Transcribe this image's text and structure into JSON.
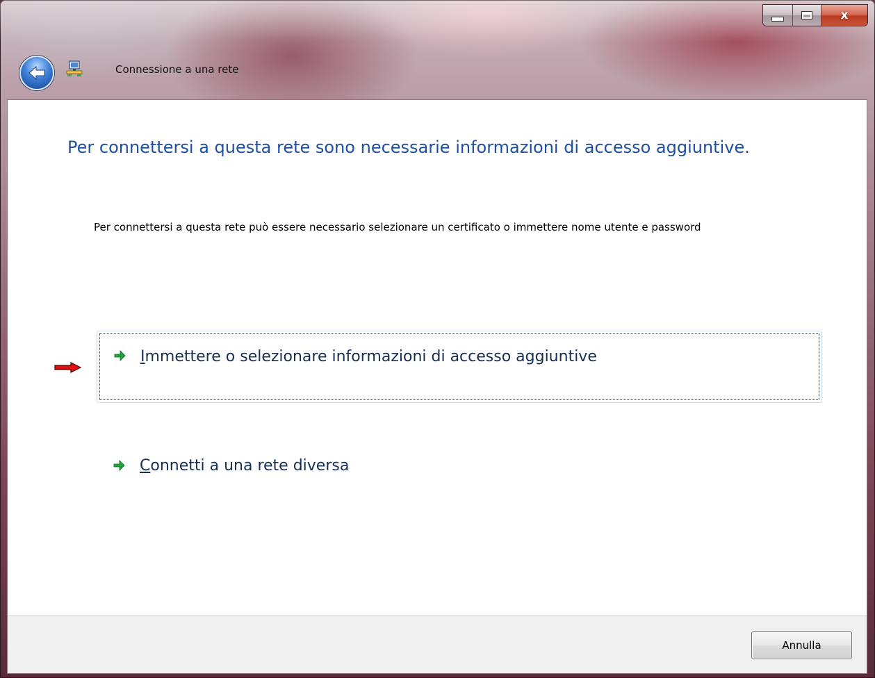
{
  "window": {
    "title": "Connessione a una rete",
    "caption_buttons": [
      "minimize",
      "maximize",
      "close"
    ],
    "close_glyph": "x"
  },
  "icons": {
    "back": "back-arrow-icon",
    "network": "network-connection-icon",
    "pointer": "red-pointer-arrow-icon",
    "option_arrow": "green-arrow-icon"
  },
  "content": {
    "headline": "Per connettersi a questa rete sono necessarie informazioni di accesso aggiuntive.",
    "description": "Per connettersi a questa rete può essere necessario selezionare un certificato o immettere nome utente e password",
    "options": [
      {
        "accesskey": "I",
        "label_rest": "mmettere o selezionare informazioni di accesso aggiuntive",
        "selected": true
      },
      {
        "accesskey": "C",
        "label_rest": "onnetti a una rete diversa",
        "selected": false
      }
    ]
  },
  "footer": {
    "cancel_label": "Annulla"
  },
  "colors": {
    "headline": "#1e4fa3",
    "option_text": "#182f55",
    "arrow_green": "#22a33a",
    "pointer_red": "#e01010"
  }
}
